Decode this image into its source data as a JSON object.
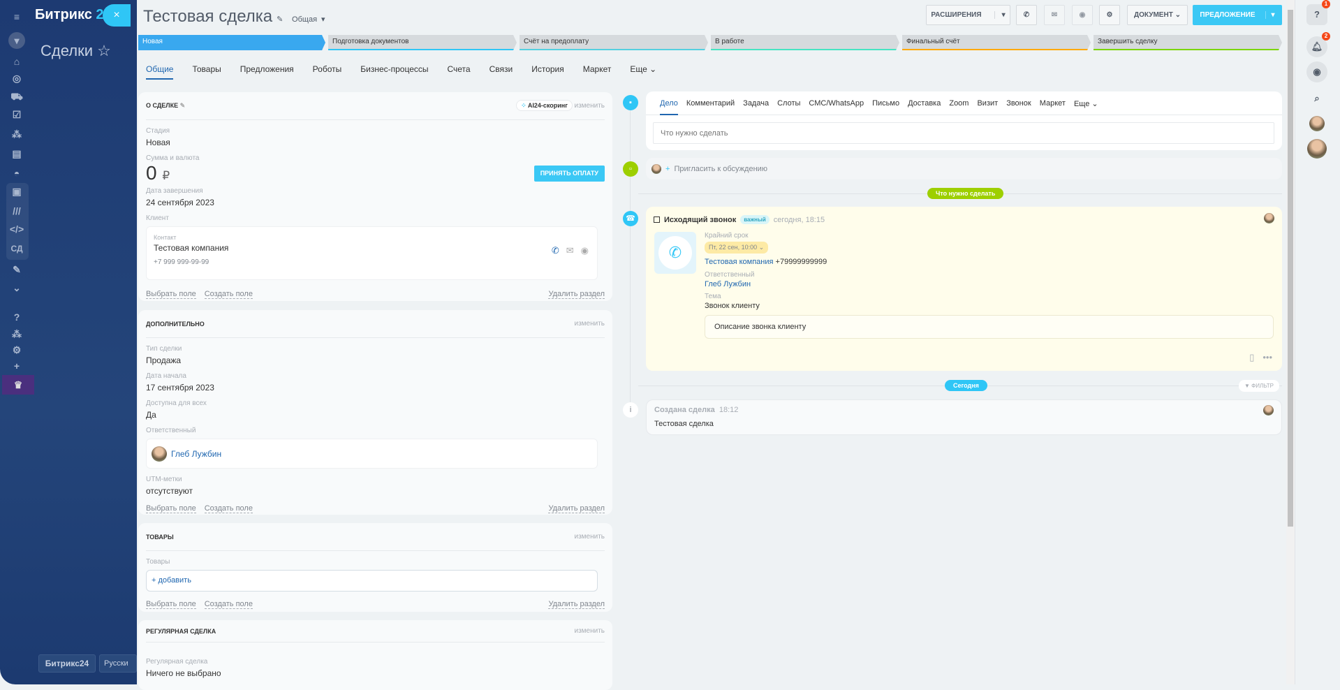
{
  "sidebar": {
    "logo": "Битрикс",
    "logo_num": "24",
    "section": "Сделки",
    "close": "×",
    "bottom_logo": "Битрикс24",
    "language": "Русски",
    "icons": [
      "menu-icon",
      "filter-icon",
      "bank-icon",
      "target-icon",
      "cart-icon",
      "task-icon",
      "sites-icon",
      "contacts-icon",
      "robot-icon",
      "box-icon",
      "market-icon",
      "code-icon",
      "sd-icon",
      "sign-icon",
      "more-icon",
      "help-icon",
      "structure-icon",
      "settings-icon",
      "plus-icon",
      "crown-icon"
    ],
    "sd_label": "СД"
  },
  "header": {
    "title": "Тестовая сделка",
    "category": "Общая",
    "extensions": "РАСШИРЕНИЯ",
    "document": "ДОКУМЕНТ",
    "offer": "ПРЕДЛОЖЕНИЕ"
  },
  "stages": [
    {
      "label": "Новая",
      "color": "#39a8ef"
    },
    {
      "label": "Подготовка документов",
      "color": "#2fc6f6"
    },
    {
      "label": "Счёт на предоплату",
      "color": "#55d0e0"
    },
    {
      "label": "В работе",
      "color": "#47e4c2"
    },
    {
      "label": "Финальный счёт",
      "color": "#ffa900"
    },
    {
      "label": "Завершить сделку",
      "color": "#7bd500"
    }
  ],
  "tabs": [
    "Общие",
    "Товары",
    "Предложения",
    "Роботы",
    "Бизнес-процессы",
    "Счета",
    "Связи",
    "История",
    "Маркет",
    "Еще"
  ],
  "about": {
    "title": "О сделке",
    "ai": "AI24-скоринг",
    "change": "изменить",
    "stage_label": "Стадия",
    "stage": "Новая",
    "sum_label": "Сумма и валюта",
    "sum": "0",
    "currency": "₽",
    "pay": "ПРИНЯТЬ ОПЛАТУ",
    "date_label": "Дата завершения",
    "date": "24 сентября 2023",
    "client_label": "Клиент",
    "contact_label": "Контакт",
    "contact": "Тестовая компания",
    "phone": "+7 999 999-99-99"
  },
  "footer": {
    "select": "Выбрать поле",
    "create": "Создать поле",
    "delete": "Удалить раздел"
  },
  "extra": {
    "title": "Дополнительно",
    "change": "изменить",
    "type_label": "Тип сделки",
    "type": "Продажа",
    "start_label": "Дата начала",
    "start": "17 сентября 2023",
    "public_label": "Доступна для всех",
    "public": "Да",
    "resp_label": "Ответственный",
    "resp": "Глеб Лужбин",
    "utm_label": "UTM-метки",
    "utm": "отсутствуют"
  },
  "goods": {
    "title": "Товары",
    "change": "изменить",
    "label": "Товары",
    "add": "+ добавить"
  },
  "regular": {
    "title": "Регулярная сделка",
    "change": "изменить",
    "label": "Регулярная сделка",
    "value": "Ничего не выбрано"
  },
  "timeline": {
    "tabs": [
      "Дело",
      "Комментарий",
      "Задача",
      "Слоты",
      "СМС/WhatsApp",
      "Письмо",
      "Доставка",
      "Zoom",
      "Визит",
      "Звонок",
      "Маркет",
      "Еще"
    ],
    "placeholder": "Что нужно сделать",
    "invite": "Пригласить к обсуждению",
    "todo_pill": "Что нужно сделать",
    "call": {
      "title": "Исходящий звонок",
      "badge": "важный",
      "time": "сегодня, 18:15",
      "deadline_label": "Крайний срок",
      "deadline": "Пт, 22 сен, 10:00",
      "company": "Тестовая компания",
      "phone": "+79999999999",
      "resp_label": "Ответственный",
      "resp": "Глеб Лужбин",
      "topic_label": "Тема",
      "topic": "Звонок клиенту",
      "description": "Описание звонка клиенту"
    },
    "today": "Сегодня",
    "filter": "ФИЛЬТР",
    "created": {
      "title": "Создана сделка",
      "time": "18:12",
      "text": "Тестовая сделка"
    }
  },
  "rightbar": {
    "help_count": "1",
    "notif_count": "2"
  }
}
